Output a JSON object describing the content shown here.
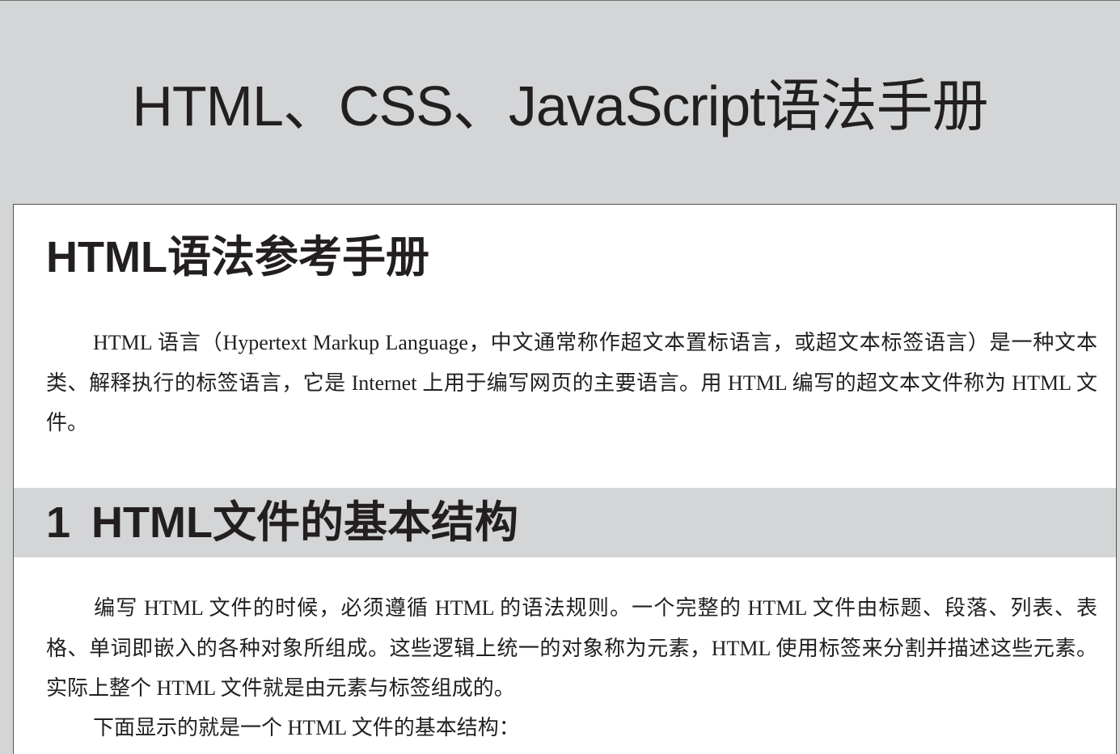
{
  "header": {
    "title": "HTML、CSS、JavaScript语法手册"
  },
  "section": {
    "heading": "HTML语法参考手册",
    "intro": "HTML 语言（Hypertext Markup Language，中文通常称作超文本置标语言，或超文本标签语言）是一种文本类、解释执行的标签语言，它是 Internet 上用于编写网页的主要语言。用 HTML 编写的超文本文件称为 HTML 文件。"
  },
  "chapter": {
    "number": "1",
    "title": "HTML文件的基本结构",
    "paragraph": "编写 HTML 文件的时候，必须遵循 HTML 的语法规则。一个完整的 HTML 文件由标题、段落、列表、表格、单词即嵌入的各种对象所组成。这些逻辑上统一的对象称为元素，HTML 使用标签来分割并描述这些元素。实际上整个 HTML 文件就是由元素与标签组成的。",
    "lead_in": "下面显示的就是一个 HTML 文件的基本结构："
  }
}
